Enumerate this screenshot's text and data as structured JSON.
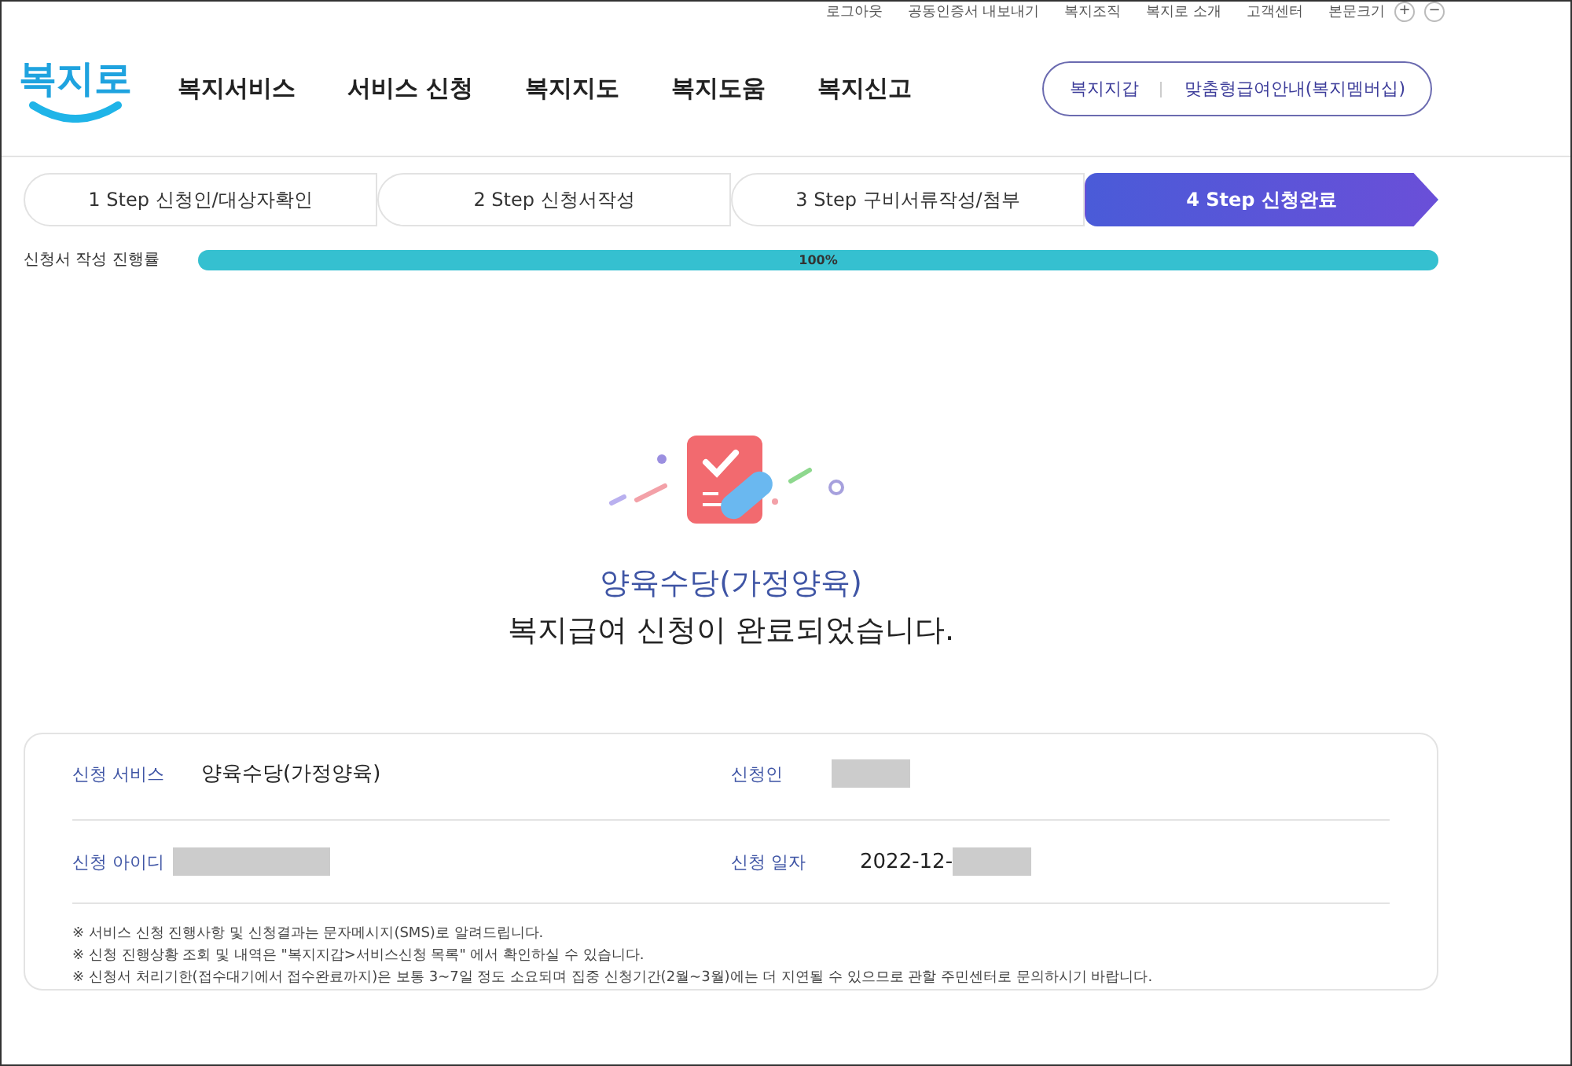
{
  "top_links": [
    "로그아웃",
    "공동인증서 내보내기",
    "복지조직",
    "복지로 소개",
    "고객센터",
    "본문크기"
  ],
  "font_size_buttons": [
    "+",
    "−"
  ],
  "logo": {
    "text": "복지로"
  },
  "nav": [
    "복지서비스",
    "서비스 신청",
    "복지지도",
    "복지도움",
    "복지신고"
  ],
  "header_buttons": [
    "복지지갑",
    "맞춤형급여안내(복지멤버십)"
  ],
  "steps": [
    {
      "label": "1 Step 신청인/대상자확인",
      "selected": false
    },
    {
      "label": "2 Step 신청서작성",
      "selected": false
    },
    {
      "label": "3 Step 구비서류작성/첨부",
      "selected": false
    },
    {
      "label": "4 Step 신청완료",
      "selected": true
    }
  ],
  "progress": {
    "label": "신청서 작성 진행률",
    "level": 1,
    "reading": "100%"
  },
  "result": {
    "service": "양육수당(가정양육)",
    "message": "복지급여 신청이 완료되었습니다."
  },
  "details": [
    [
      {
        "label": "신청 서비스",
        "value": "양육수당(가정양육)",
        "blurred": false
      },
      {
        "label": "신청인",
        "blurred": true
      }
    ],
    [
      {
        "label": "신청 아이디",
        "blurred": true
      },
      {
        "label": "신청 일자",
        "value": "2022-12-",
        "blurred": true
      }
    ]
  ],
  "notes": [
    "※ 서비스 신청 진행사항 및 신청결과는 문자메시지(SMS)로 알려드립니다.",
    "※ 신청 진행상황 조회 및 내역은 \"복지지갑>서비스신청 목록\" 에서 확인하실 수 있습니다.",
    "※ 신청서 처리기한(접수대기에서 접수완료까지)은 보통 3~7일 정도 소요되며 집중 신청기간(2월~3월)에는 더 지연될 수 있으므로 관할 주민센터로 문의하시기 바랍니다."
  ]
}
